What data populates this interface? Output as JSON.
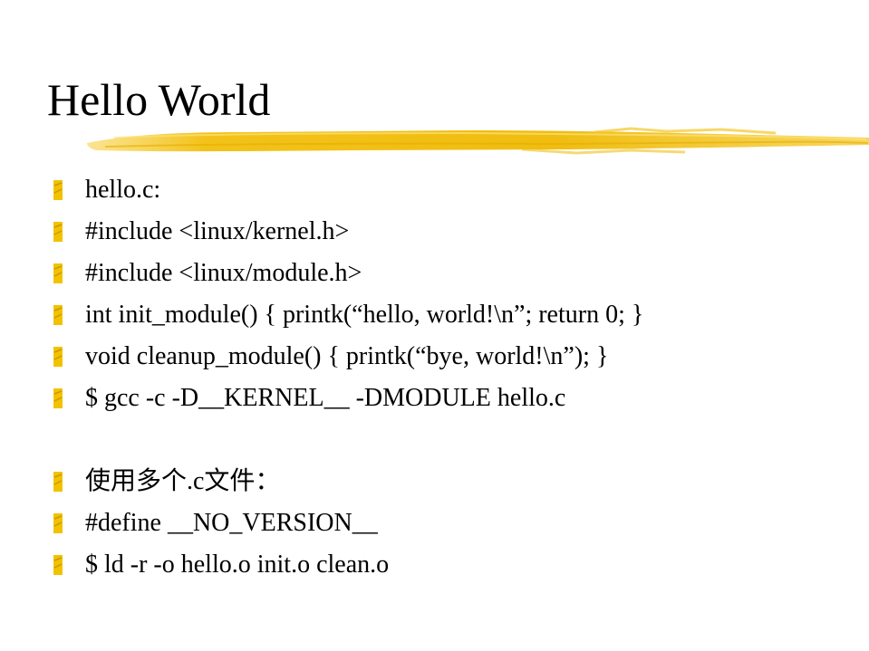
{
  "title": "Hello World",
  "accent_color": "#f2c200",
  "bullet_icon": "yellow-z-bullet",
  "bullets": [
    {
      "text": "hello.c:"
    },
    {
      "text": "#include <linux/kernel.h>"
    },
    {
      "text": "#include <linux/module.h>"
    },
    {
      "text": "int init_module() { printk(“hello, world!\\n”; return 0; }"
    },
    {
      "text": "void cleanup_module() { printk(“bye, world!\\n”); }"
    },
    {
      "text": "$ gcc -c -D__KERNEL__ -DMODULE hello.c"
    },
    {
      "text": "使用多个.c文件："
    },
    {
      "text": "#define __NO_VERSION__"
    },
    {
      "text": "$ ld -r -o hello.o init.o clean.o"
    }
  ]
}
